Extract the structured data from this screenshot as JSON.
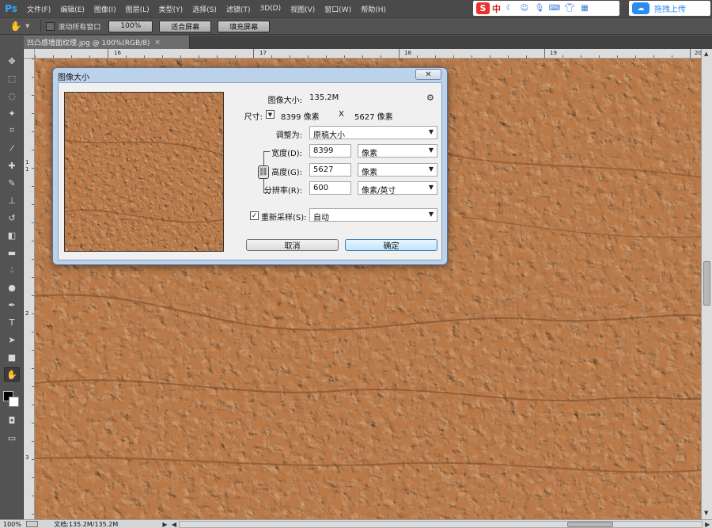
{
  "app": {
    "logo": "Ps"
  },
  "menu": [
    "文件(F)",
    "编辑(E)",
    "图像(I)",
    "图层(L)",
    "类型(Y)",
    "选择(S)",
    "滤镜(T)",
    "3D(D)",
    "视图(V)",
    "窗口(W)",
    "帮助(H)"
  ],
  "ime": {
    "logo": "S",
    "mode": "中",
    "icons": [
      "moon-icon",
      "smile-icon",
      "mic-icon",
      "keyboard-icon",
      "shirt-icon",
      "shirt-icon",
      "grid-icon"
    ]
  },
  "cloud": {
    "label": "拖拽上传"
  },
  "options": {
    "scroll_all_label": "滚动所有窗口",
    "zoom_100": "100%",
    "fit_screen": "适合屏幕",
    "fill_screen": "填充屏幕"
  },
  "document": {
    "tab_title": "凹凸感墙面纹理.jpg @ 100%(RGB/8)",
    "close": "×"
  },
  "rulers": {
    "top_labels": [
      "16",
      "17",
      "18",
      "19",
      "20"
    ],
    "left_labels": [
      "1",
      "1",
      "2",
      "3"
    ]
  },
  "status": {
    "zoom": "100%",
    "doc_info": "文档:135.2M/135.2M"
  },
  "dialog": {
    "title": "图像大小",
    "close": "✕",
    "image_size_label": "图像大小:",
    "image_size_value": "135.2M",
    "dimensions_label": "尺寸:",
    "dimensions_width": "8399 像素",
    "dimensions_x": "X",
    "dimensions_height": "5627 像素",
    "fit_to_label": "调整为:",
    "fit_to_value": "原稿大小",
    "width_label": "宽度(D):",
    "width_value": "8399",
    "width_unit": "像素",
    "height_label": "高度(G):",
    "height_value": "5627",
    "height_unit": "像素",
    "resolution_label": "分辨率(R):",
    "resolution_value": "600",
    "resolution_unit": "像素/英寸",
    "resample_label": "重新采样(S):",
    "resample_value": "自动",
    "cancel": "取消",
    "ok": "确定"
  },
  "colors": {
    "canvas_base": "#b9794a",
    "canvas_highlight": "#e3ad7c",
    "canvas_shadow": "#7a4a26",
    "dialog_frame": "#bcd2ea",
    "primary_button": "#bee6fd"
  }
}
